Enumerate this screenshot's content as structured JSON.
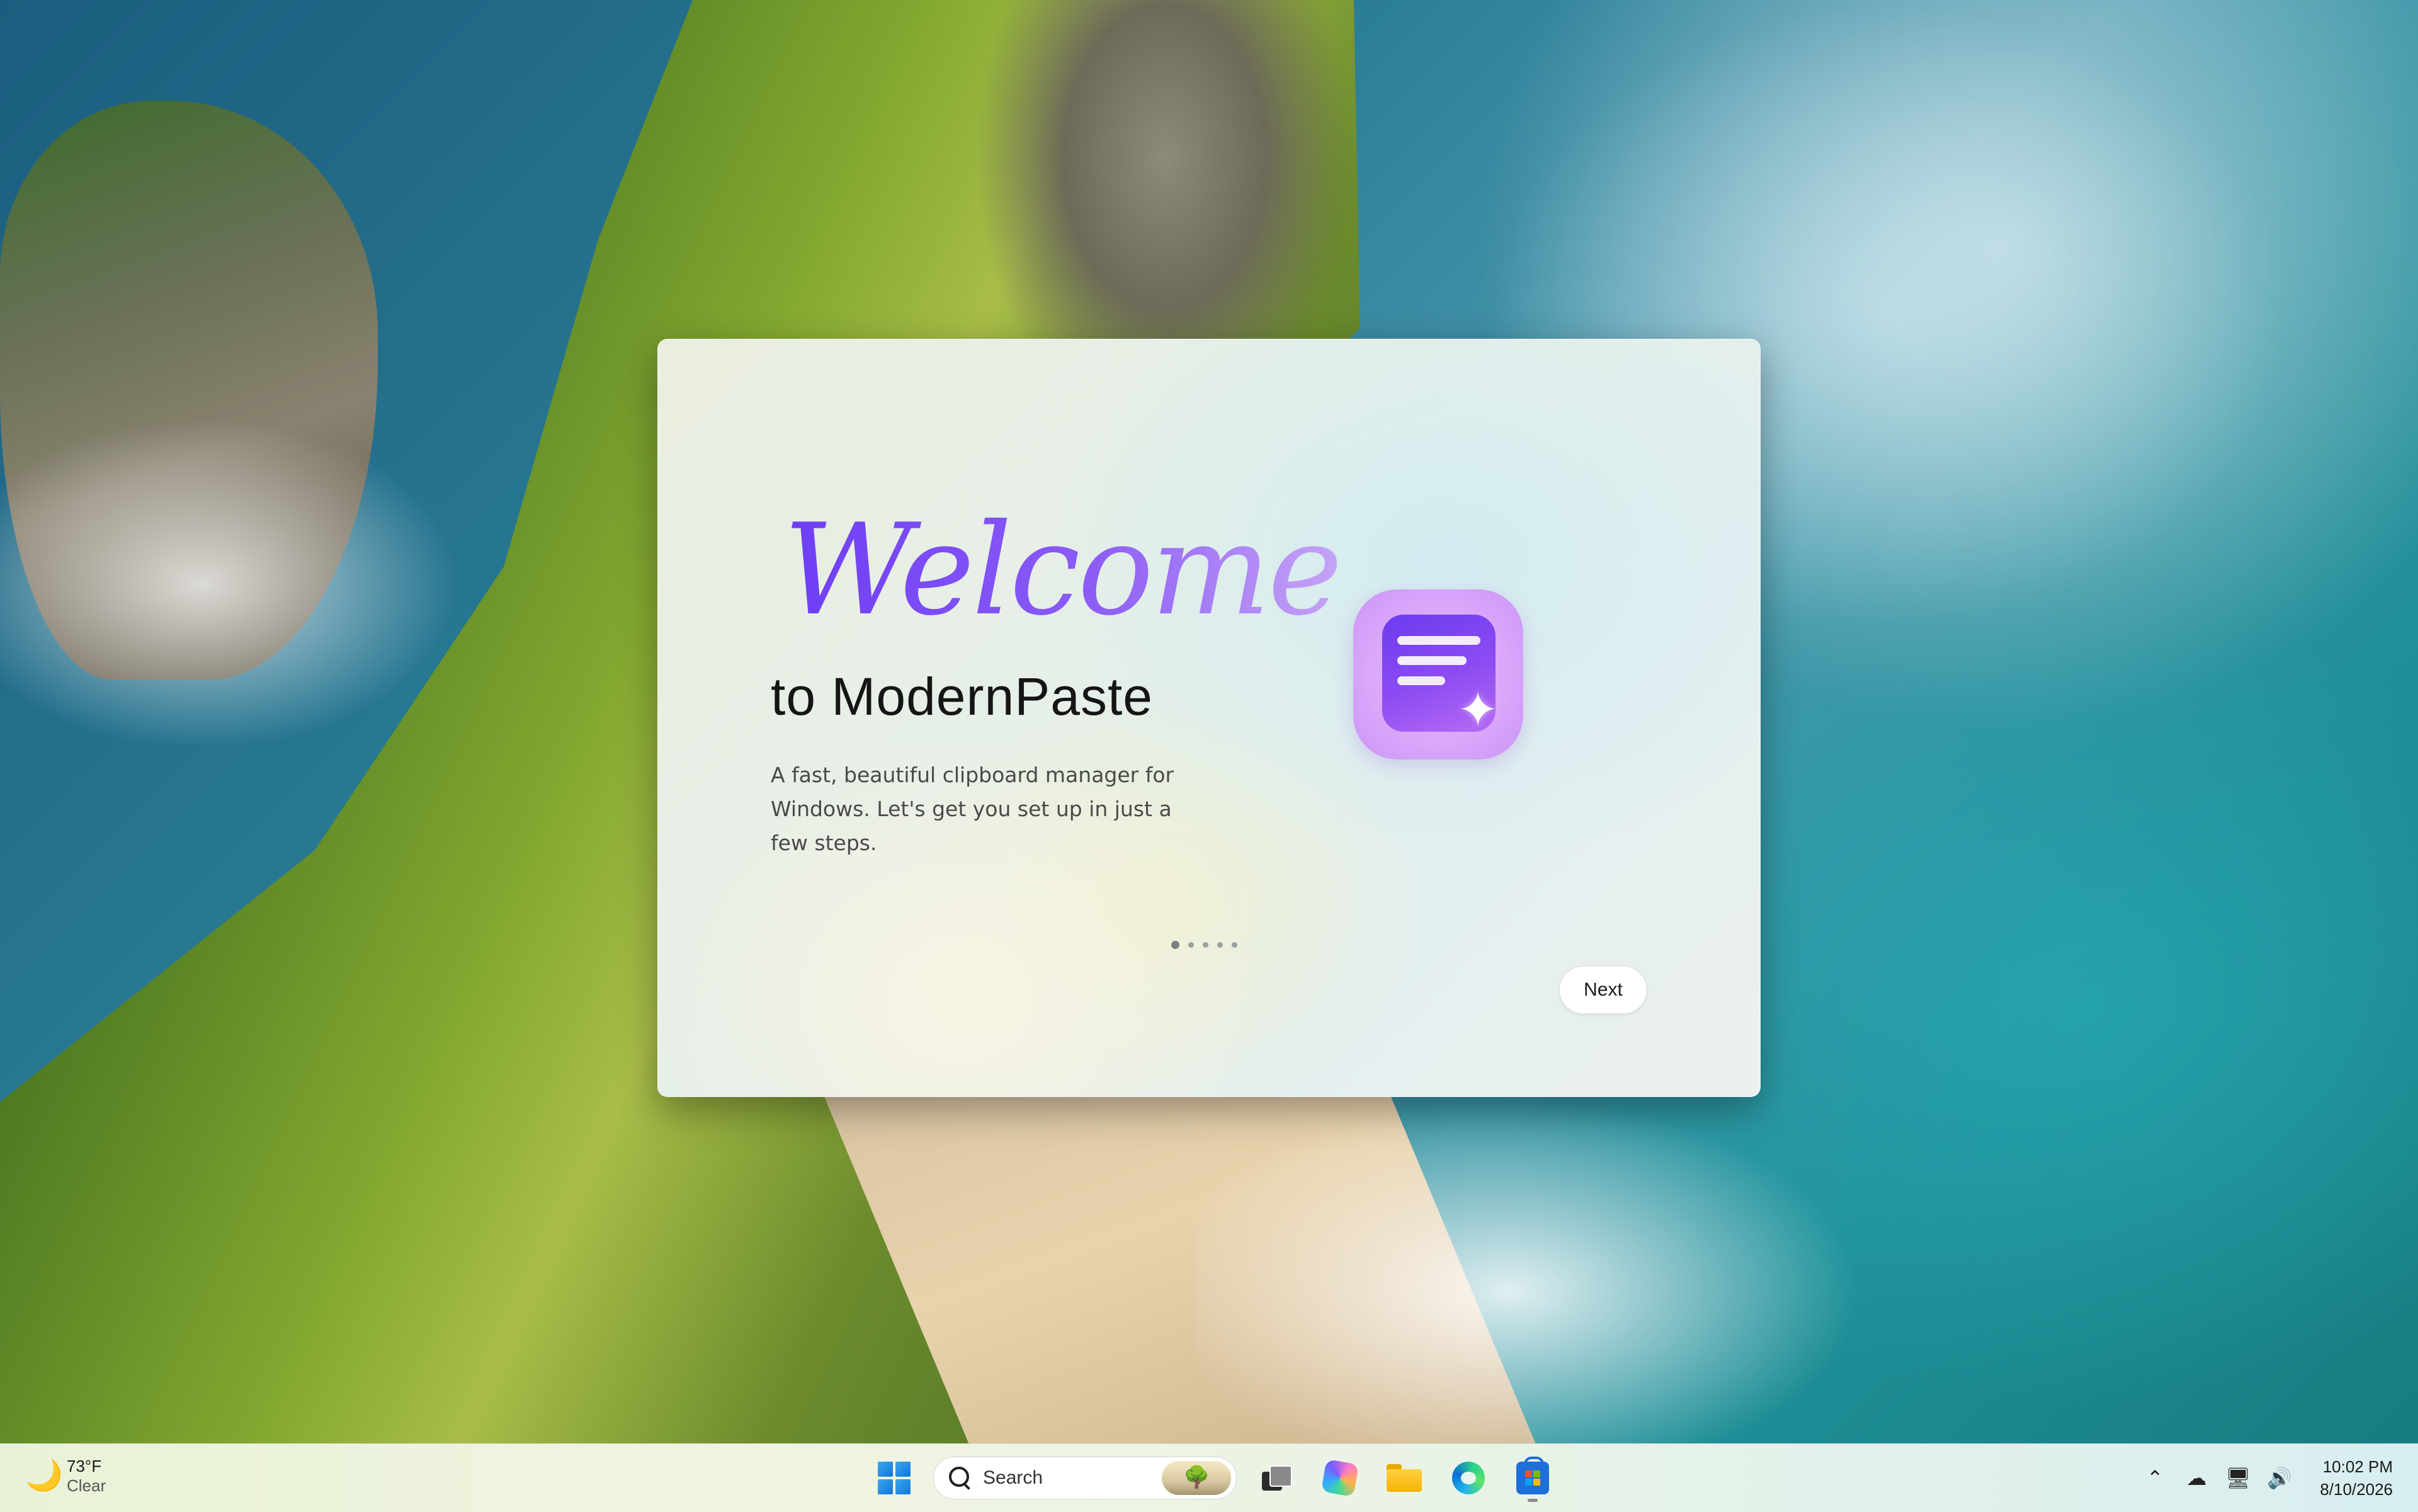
{
  "dialog": {
    "welcome": "Welcome",
    "title": "to ModernPaste",
    "description": "A fast, beautiful clipboard manager for Windows. Let's get you set up in just a few steps.",
    "next_label": "Next",
    "steps_total": 5,
    "step_current": 1
  },
  "taskbar": {
    "weather": {
      "temp": "73°F",
      "condition": "Clear",
      "icon": "moon-icon"
    },
    "search": {
      "placeholder": "Search"
    },
    "pinned": [
      "start",
      "search",
      "task-view",
      "copilot",
      "file-explorer",
      "edge",
      "microsoft-store"
    ],
    "clock": {
      "time": "10:02 PM",
      "date": "8/10/2026"
    }
  },
  "colors": {
    "accent_purple": "#8b5cf6",
    "taskbar_bg": "#eef3e2",
    "window_blue": "#1e6fd9"
  }
}
